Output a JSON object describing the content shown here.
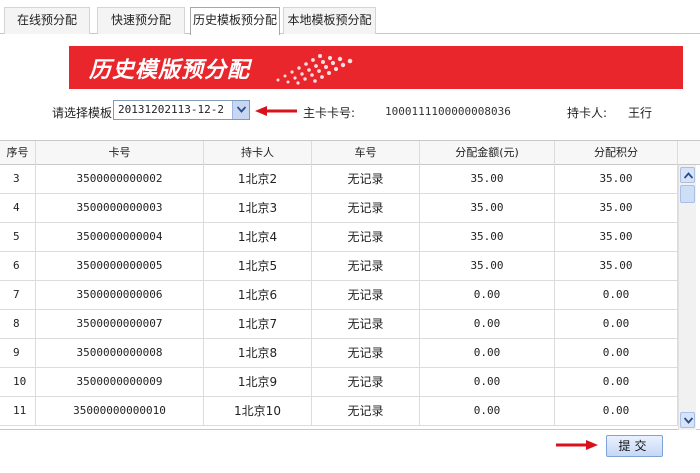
{
  "tabs": [
    {
      "label": "在线预分配",
      "active": false
    },
    {
      "label": "快速预分配",
      "active": false
    },
    {
      "label": "历史模板预分配",
      "active": true
    },
    {
      "label": "本地模板预分配",
      "active": false
    }
  ],
  "banner": {
    "title": "历史模版预分配"
  },
  "template": {
    "label": "请选择模板",
    "selected": "20131202113-12-2",
    "main_card_label": "主卡卡号:",
    "main_card_value": "1000111100000008036",
    "holder_label": "持卡人:",
    "holder_value": "王行"
  },
  "table": {
    "headers": [
      "序号",
      "卡号",
      "持卡人",
      "车号",
      "分配金额(元)",
      "分配积分"
    ],
    "rows": [
      [
        "3",
        "3500000000002",
        "1北京2",
        "无记录",
        "35.00",
        "35.00"
      ],
      [
        "4",
        "3500000000003",
        "1北京3",
        "无记录",
        "35.00",
        "35.00"
      ],
      [
        "5",
        "3500000000004",
        "1北京4",
        "无记录",
        "35.00",
        "35.00"
      ],
      [
        "6",
        "3500000000005",
        "1北京5",
        "无记录",
        "35.00",
        "35.00"
      ],
      [
        "7",
        "3500000000006",
        "1北京6",
        "无记录",
        "0.00",
        "0.00"
      ],
      [
        "8",
        "3500000000007",
        "1北京7",
        "无记录",
        "0.00",
        "0.00"
      ],
      [
        "9",
        "3500000000008",
        "1北京8",
        "无记录",
        "0.00",
        "0.00"
      ],
      [
        "10",
        "3500000000009",
        "1北京9",
        "无记录",
        "0.00",
        "0.00"
      ],
      [
        "11",
        "35000000000010",
        "1北京10",
        "无记录",
        "0.00",
        "0.00"
      ]
    ]
  },
  "submit": {
    "label": "提交"
  },
  "colors": {
    "banner_red": "#e8262c",
    "arrow_red": "#d8121b"
  },
  "icons": {
    "select_arrow": "chevron-down-icon",
    "pointer_arrow": "left-arrow-icon"
  }
}
